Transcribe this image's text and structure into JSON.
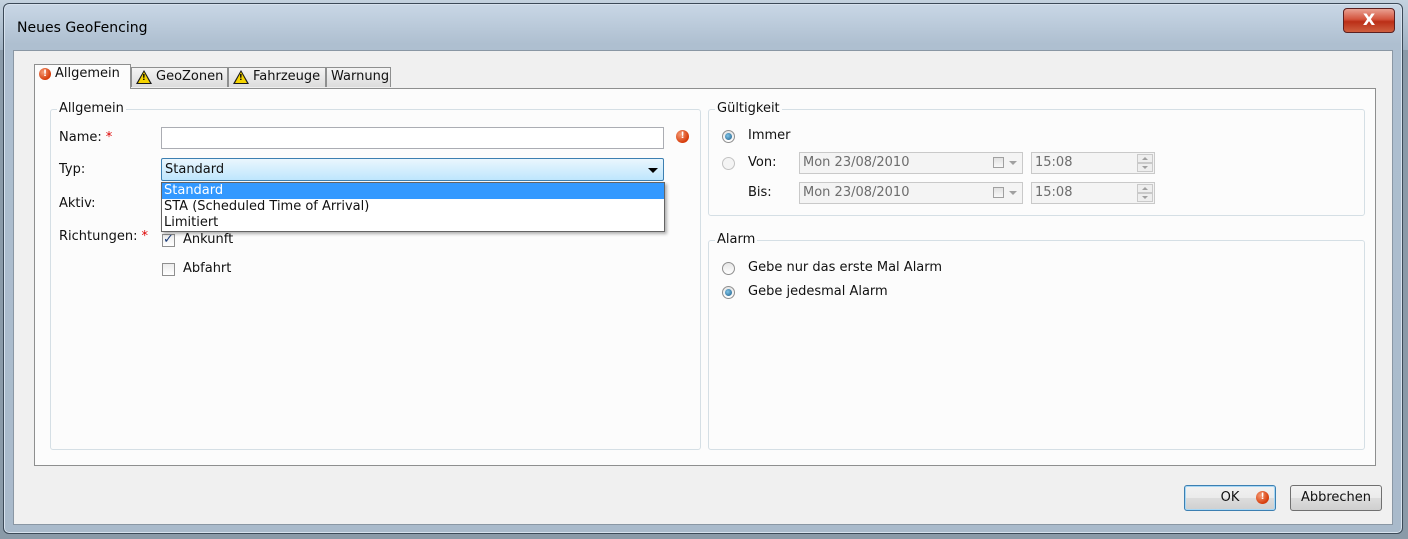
{
  "window": {
    "title": "Neues GeoFencing",
    "close_glyph": "X"
  },
  "tabs": [
    {
      "label": "Allgemein",
      "icon": "error-icon",
      "active": true
    },
    {
      "label": "GeoZonen",
      "icon": "warning-icon",
      "active": false
    },
    {
      "label": "Fahrzeuge",
      "icon": "warning-icon",
      "active": false
    },
    {
      "label": "Warnung",
      "icon": "",
      "active": false
    }
  ],
  "general": {
    "legend": "Allgemein",
    "name_label": "Name:",
    "name_value": "",
    "required_mark": "*",
    "type_label": "Typ:",
    "type_value": "Standard",
    "type_options": [
      "Standard",
      "STA (Scheduled Time of Arrival)",
      "Limitiert"
    ],
    "active_label": "Aktiv:",
    "directions_label": "Richtungen:",
    "arrival_label": "Ankunft",
    "arrival_checked": true,
    "departure_label": "Abfahrt",
    "departure_checked": false
  },
  "validity": {
    "legend": "Gültigkeit",
    "always_label": "Immer",
    "from_label": "Von:",
    "to_label": "Bis:",
    "from_date": "Mon 23/08/2010",
    "from_time": "15:08",
    "to_date": "Mon 23/08/2010",
    "to_time": "15:08"
  },
  "alarm": {
    "legend": "Alarm",
    "first_only_label": "Gebe nur das erste Mal Alarm",
    "every_time_label": "Gebe jedesmal Alarm"
  },
  "buttons": {
    "ok_label": "OK",
    "cancel_label": "Abbrechen"
  },
  "colors": {
    "error": "#d63b0a",
    "selection": "#3399ff",
    "required": "#dd0000"
  }
}
